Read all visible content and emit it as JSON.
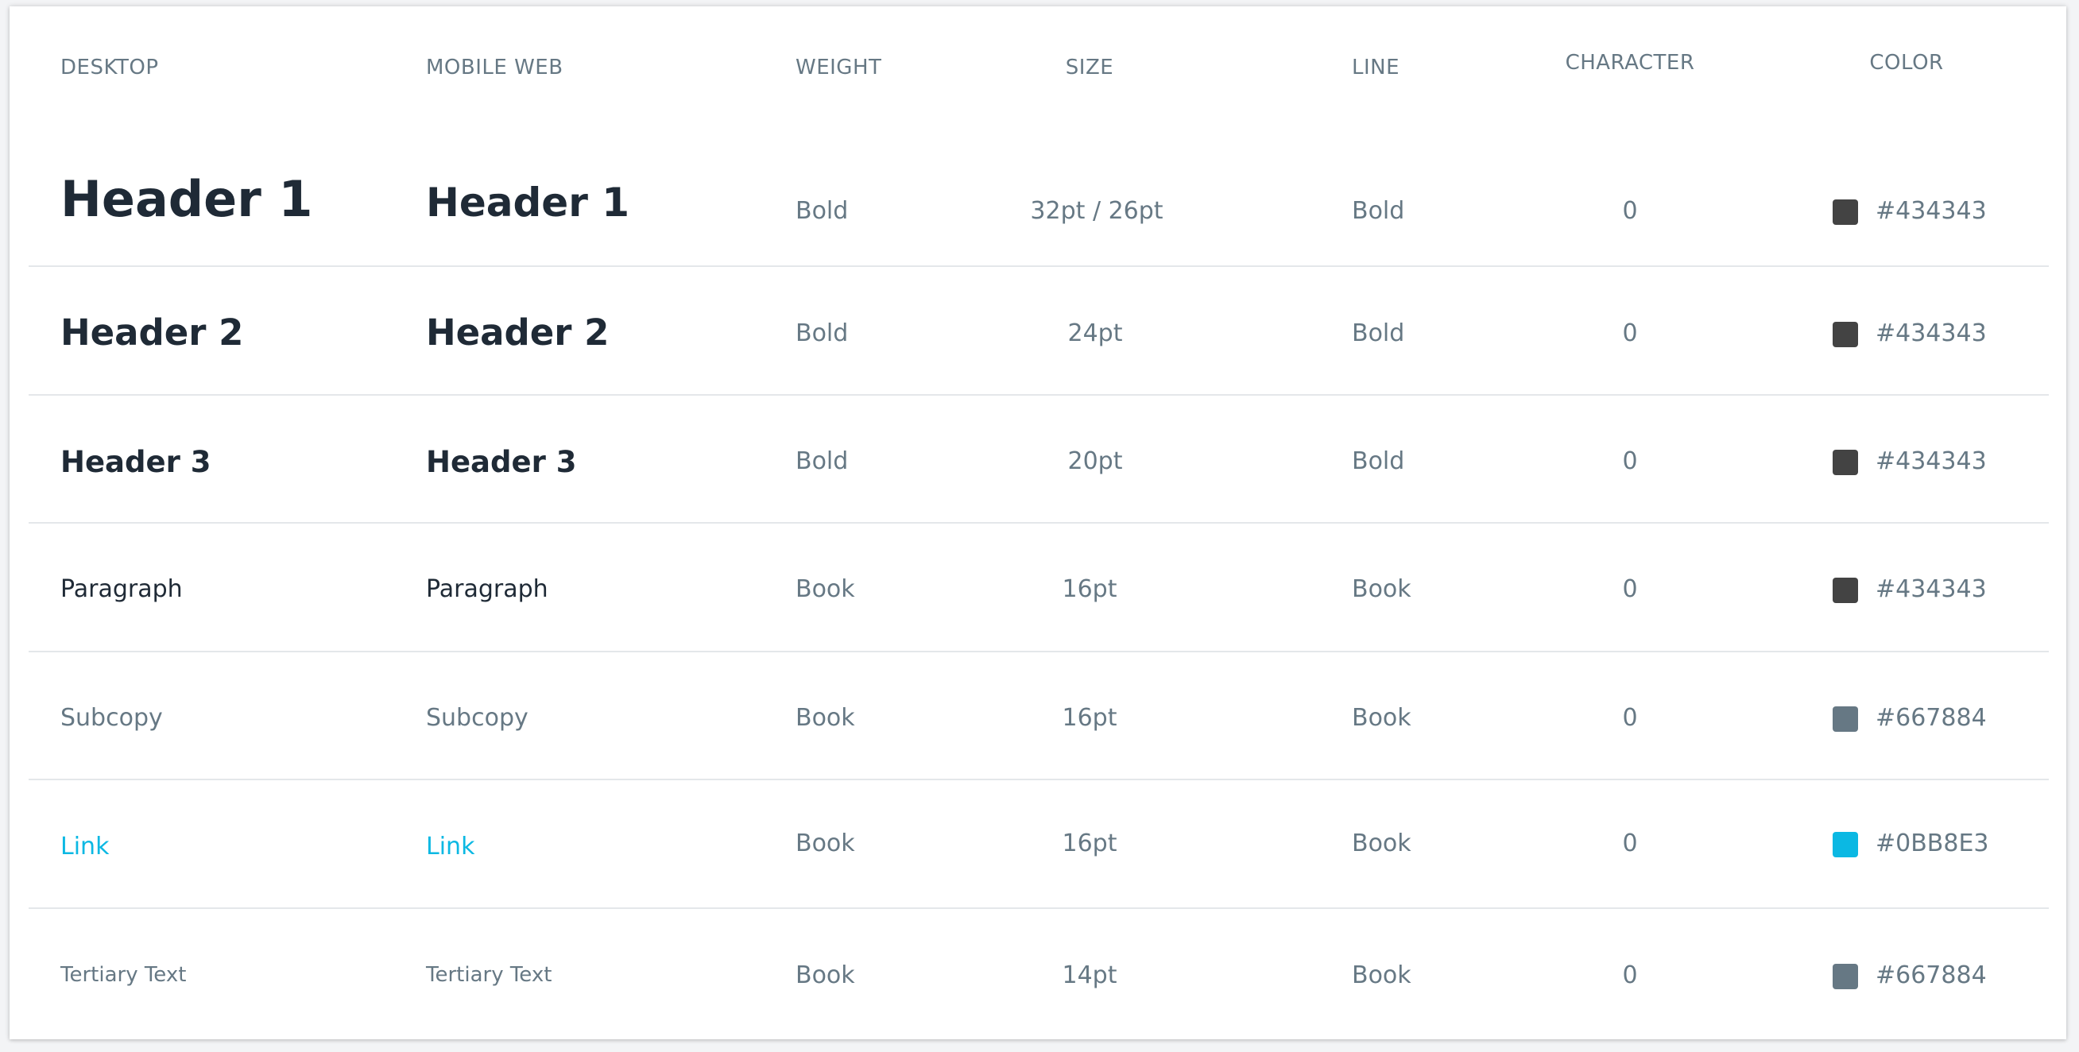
{
  "headers": {
    "desktop": "DESKTOP",
    "mobile_web": "MOBILE WEB",
    "weight": "WEIGHT",
    "size": "SIZE",
    "line": "LINE",
    "character": "CHARACTER",
    "color": "COLOR"
  },
  "rows": [
    {
      "desktop": "Header 1",
      "mobile": "Header 1",
      "weight": "Bold",
      "size": "32pt / 26pt",
      "line": "Bold",
      "character": "0",
      "color": "#434343"
    },
    {
      "desktop": "Header 2",
      "mobile": "Header 2",
      "weight": "Bold",
      "size": "24pt",
      "line": "Bold",
      "character": "0",
      "color": "#434343"
    },
    {
      "desktop": "Header 3",
      "mobile": "Header 3",
      "weight": "Bold",
      "size": "20pt",
      "line": "Bold",
      "character": "0",
      "color": "#434343"
    },
    {
      "desktop": "Paragraph",
      "mobile": "Paragraph",
      "weight": "Book",
      "size": "16pt",
      "line": "Book",
      "character": "0",
      "color": "#434343"
    },
    {
      "desktop": "Subcopy",
      "mobile": "Subcopy",
      "weight": "Book",
      "size": "16pt",
      "line": "Book",
      "character": "0",
      "color": "#667884"
    },
    {
      "desktop": "Link",
      "mobile": "Link",
      "weight": "Book",
      "size": "16pt",
      "line": "Book",
      "character": "0",
      "color": "#0BB8E3"
    },
    {
      "desktop": "Tertiary Text",
      "mobile": "Tertiary Text",
      "weight": "Book",
      "size": "14pt",
      "line": "Book",
      "character": "0",
      "color": "#667884"
    }
  ],
  "colors": {
    "text_dark": "#1f2a36",
    "text_muted": "#667884",
    "link": "#0BB8E3",
    "swatch_dark": "#434343",
    "swatch_muted": "#667884",
    "swatch_link": "#0BB8E3"
  }
}
